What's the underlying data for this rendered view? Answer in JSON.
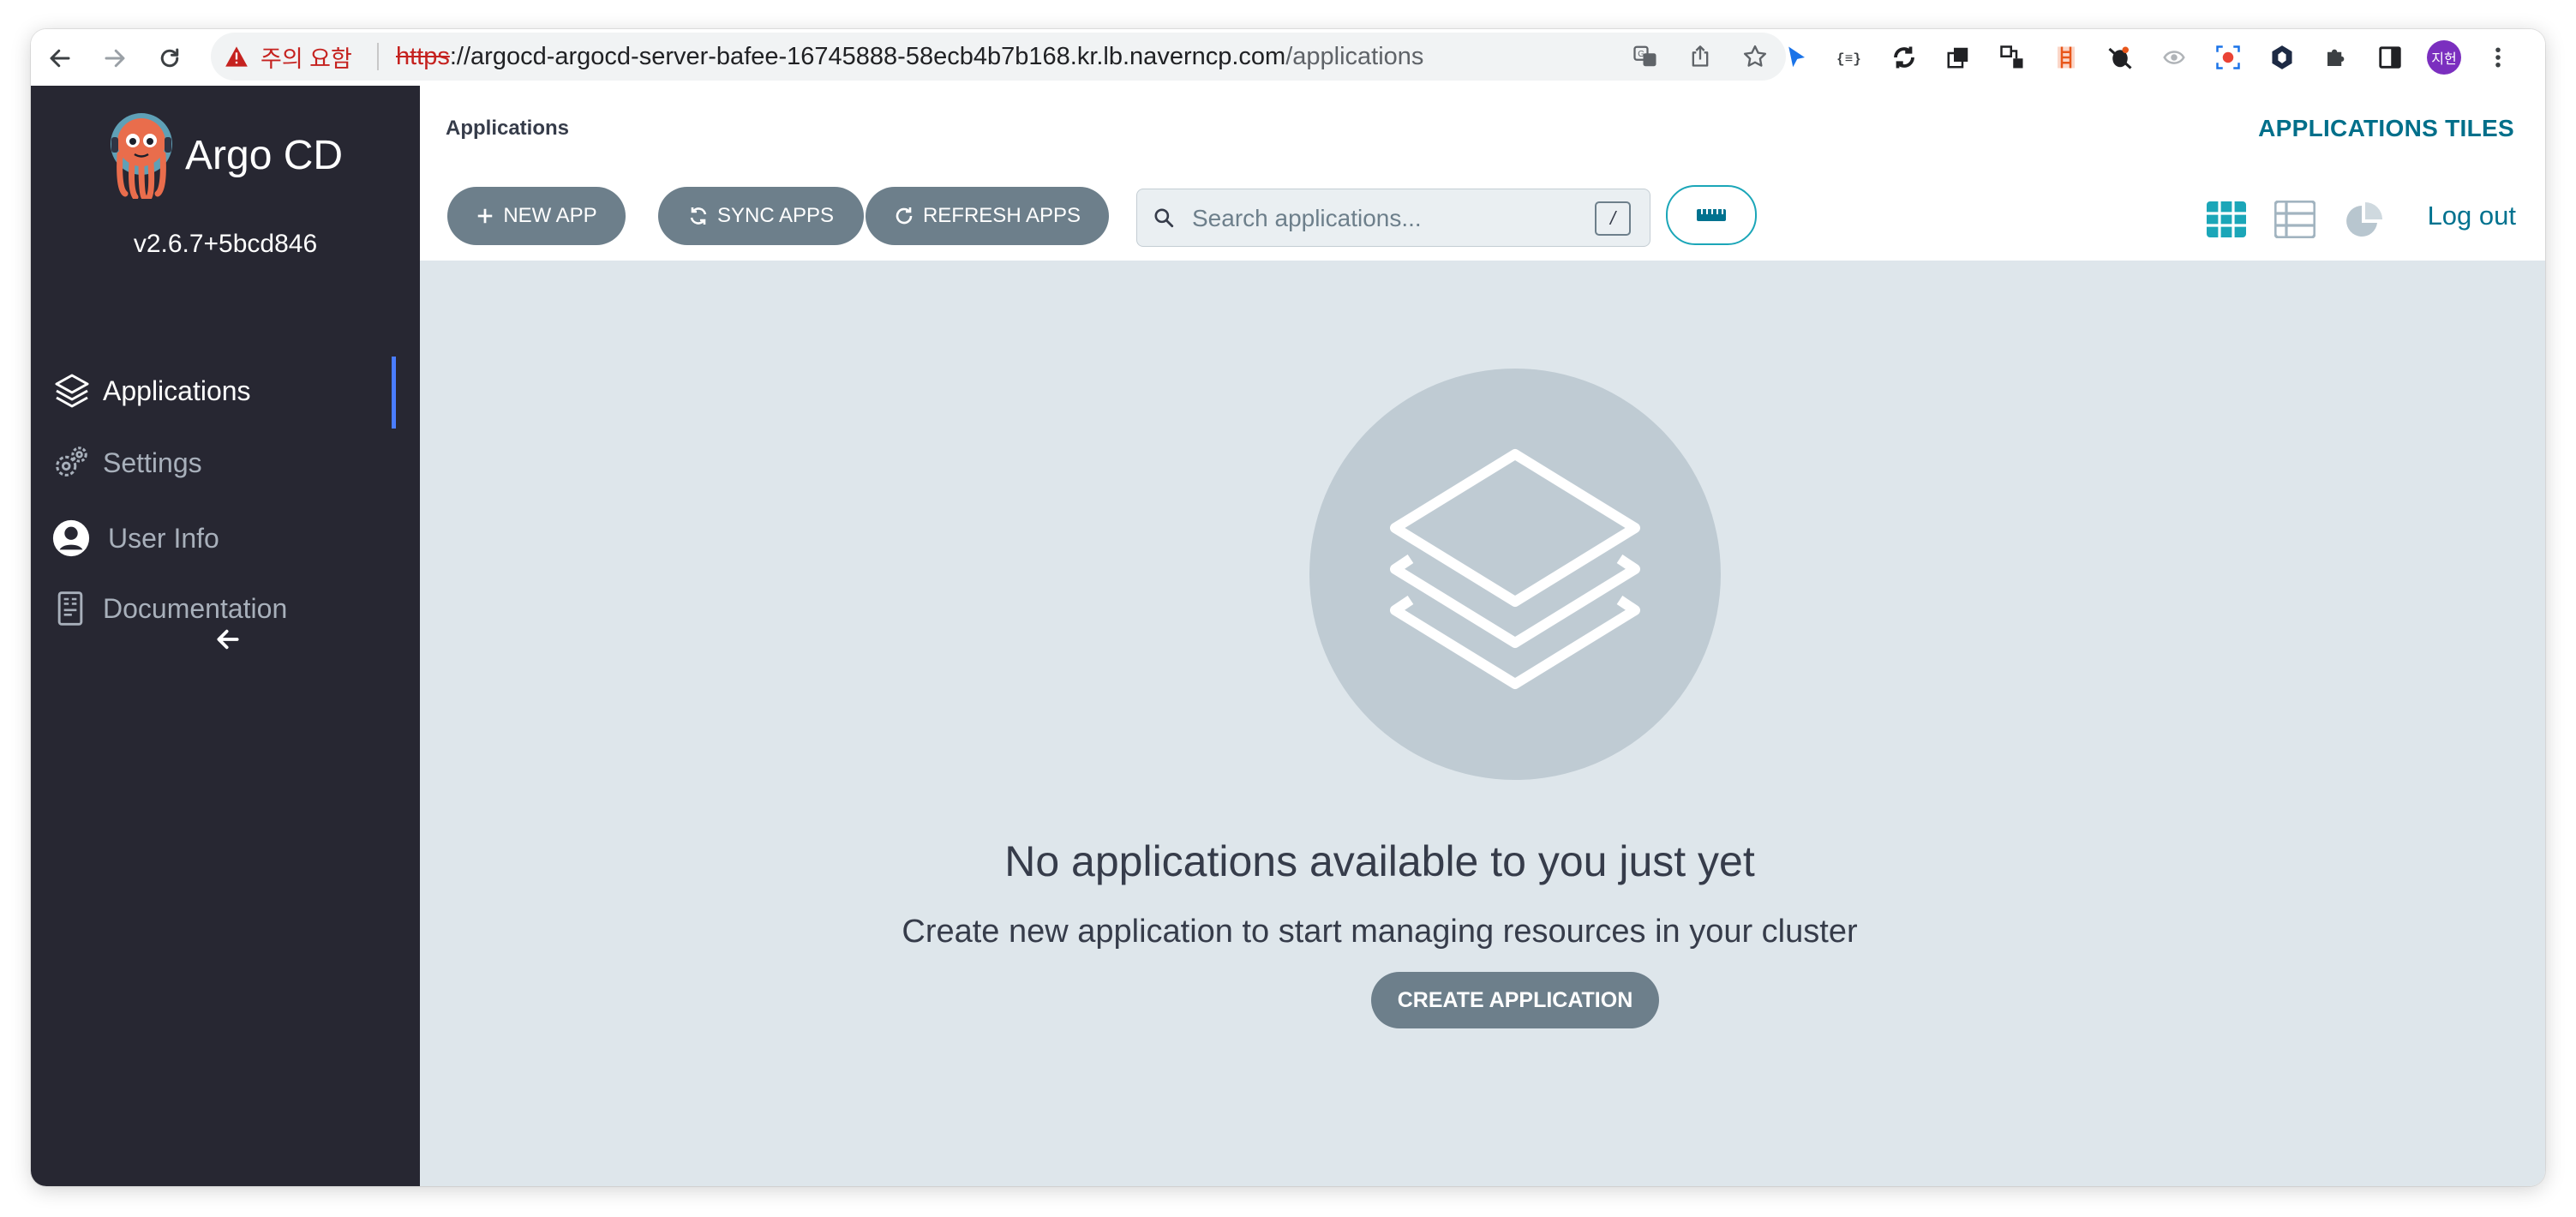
{
  "browser": {
    "warning_label": "주의 요함",
    "url_protocol": "https",
    "url_host": "://argocd-argocd-server-bafee-16745888-58ecb4b7b168.kr.lb.naverncp.com",
    "url_path": "/applications",
    "profile_initials": "지헌"
  },
  "sidebar": {
    "logo_text": "Argo CD",
    "version": "v2.6.7+5bcd846",
    "items": [
      {
        "label": "Applications",
        "icon": "layers-icon"
      },
      {
        "label": "Settings",
        "icon": "gears-icon"
      },
      {
        "label": "User Info",
        "icon": "user-circle-icon"
      },
      {
        "label": "Documentation",
        "icon": "book-icon"
      }
    ]
  },
  "header": {
    "breadcrumb": "Applications",
    "view_title": "APPLICATIONS TILES"
  },
  "toolbar": {
    "new_app_label": "NEW APP",
    "sync_apps_label": "SYNC APPS",
    "refresh_apps_label": "REFRESH APPS",
    "search_placeholder": "Search applications...",
    "search_shortcut": "/",
    "logout_label": "Log out"
  },
  "empty_state": {
    "title": "No applications available to you just yet",
    "subtitle": "Create new application to start managing resources in your cluster",
    "button_label": "CREATE APPLICATION"
  },
  "colors": {
    "sidebar_bg": "#272732",
    "accent": "#1ba6b8",
    "button_bg": "#6d7f8b",
    "content_bg": "#dee6eb"
  }
}
